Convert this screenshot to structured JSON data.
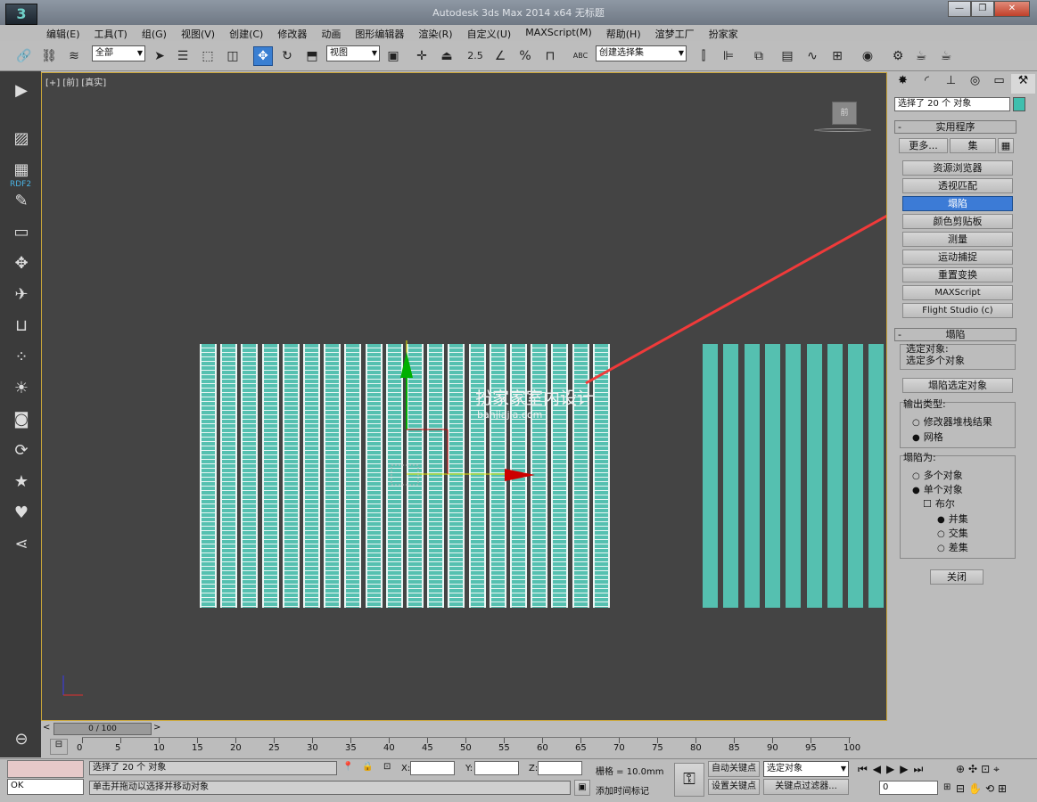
{
  "window": {
    "title": "Autodesk 3ds Max  2014 x64      无标题",
    "logo": "3",
    "controls": [
      "—",
      "❐",
      "✕"
    ]
  },
  "menu": [
    "编辑(E)",
    "工具(T)",
    "组(G)",
    "视图(V)",
    "创建(C)",
    "修改器",
    "动画",
    "图形编辑器",
    "渲染(R)",
    "自定义(U)",
    "MAXScript(M)",
    "帮助(H)",
    "渲梦工厂",
    "扮家家"
  ],
  "toolbar": {
    "selection_filter": "全部",
    "ref_coord": "视图",
    "snap_angle": "2.5",
    "snap_percent": "%",
    "named_selection": "创建选择集",
    "text_icon": "ABC"
  },
  "leftbar": {
    "brand": "RDF2"
  },
  "viewport": {
    "label": "[+] [前] [真实]",
    "viewcube": "前",
    "watermark_text": "扮家家室内设计",
    "watermark_url": "banjiajia.com"
  },
  "timeline": {
    "frame_display": "0 / 100",
    "ticks": [
      "0",
      "5",
      "10",
      "15",
      "20",
      "25",
      "30",
      "35",
      "40",
      "45",
      "50",
      "55",
      "60",
      "65",
      "70",
      "75",
      "80",
      "85",
      "90",
      "95",
      "100"
    ]
  },
  "cmdpanel": {
    "selection_name": "选择了 20 个 对象",
    "accent_color": "#3fbfae",
    "utilities_header": "实用程序",
    "more_btn": "更多...",
    "sets_btn": "集",
    "utility_buttons": [
      "资源浏览器",
      "透视匹配",
      "塌陷",
      "颜色剪贴板",
      "测量",
      "运动捕捉",
      "重置变换",
      "MAXScript",
      "Flight Studio (c)"
    ],
    "collapse_header": "塌陷",
    "selected_label": "选定对象:",
    "selected_value": "选定多个对象",
    "collapse_btn": "塌陷选定对象",
    "output_type_label": "输出类型:",
    "output_options": [
      "修改器堆栈结果",
      "网格"
    ],
    "collapse_to_label": "塌陷为:",
    "collapse_to_options": [
      "多个对象",
      "单个对象"
    ],
    "boolean_label": "布尔",
    "boolean_options": [
      "并集",
      "交集",
      "差集"
    ],
    "close_btn": "关闭"
  },
  "status": {
    "selection_status": "选择了 20 个 对象",
    "prompt": "单击并拖动以选择并移动对象",
    "listener": "OK",
    "x_label": "X:",
    "y_label": "Y:",
    "z_label": "Z:",
    "grid": "栅格 = 10.0mm",
    "add_time_tag": "添加时间标记",
    "auto_key": "自动关键点",
    "set_key": "设置关键点",
    "key_mode": "选定对象",
    "key_filters": "关键点过滤器...",
    "current_frame": "0"
  }
}
